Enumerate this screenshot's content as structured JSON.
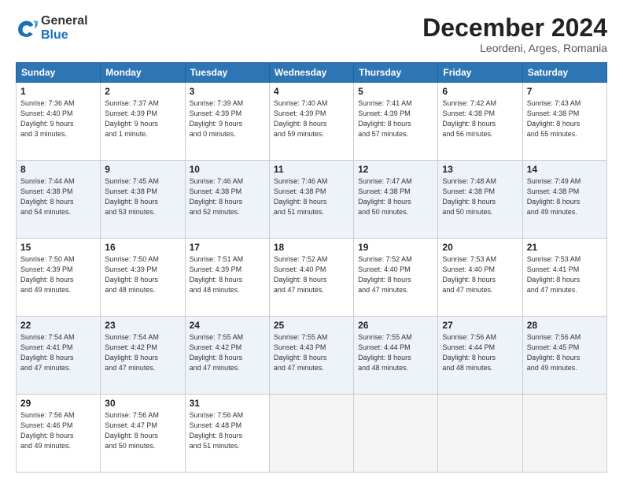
{
  "header": {
    "logo_general": "General",
    "logo_blue": "Blue",
    "month": "December 2024",
    "location": "Leordeni, Arges, Romania"
  },
  "weekdays": [
    "Sunday",
    "Monday",
    "Tuesday",
    "Wednesday",
    "Thursday",
    "Friday",
    "Saturday"
  ],
  "weeks": [
    [
      {
        "day": "1",
        "sunrise": "7:36 AM",
        "sunset": "4:40 PM",
        "daylight": "9 hours and 3 minutes."
      },
      {
        "day": "2",
        "sunrise": "7:37 AM",
        "sunset": "4:39 PM",
        "daylight": "9 hours and 1 minute."
      },
      {
        "day": "3",
        "sunrise": "7:39 AM",
        "sunset": "4:39 PM",
        "daylight": "9 hours and 0 minutes."
      },
      {
        "day": "4",
        "sunrise": "7:40 AM",
        "sunset": "4:39 PM",
        "daylight": "8 hours and 59 minutes."
      },
      {
        "day": "5",
        "sunrise": "7:41 AM",
        "sunset": "4:39 PM",
        "daylight": "8 hours and 57 minutes."
      },
      {
        "day": "6",
        "sunrise": "7:42 AM",
        "sunset": "4:38 PM",
        "daylight": "8 hours and 56 minutes."
      },
      {
        "day": "7",
        "sunrise": "7:43 AM",
        "sunset": "4:38 PM",
        "daylight": "8 hours and 55 minutes."
      }
    ],
    [
      {
        "day": "8",
        "sunrise": "7:44 AM",
        "sunset": "4:38 PM",
        "daylight": "8 hours and 54 minutes."
      },
      {
        "day": "9",
        "sunrise": "7:45 AM",
        "sunset": "4:38 PM",
        "daylight": "8 hours and 53 minutes."
      },
      {
        "day": "10",
        "sunrise": "7:46 AM",
        "sunset": "4:38 PM",
        "daylight": "8 hours and 52 minutes."
      },
      {
        "day": "11",
        "sunrise": "7:46 AM",
        "sunset": "4:38 PM",
        "daylight": "8 hours and 51 minutes."
      },
      {
        "day": "12",
        "sunrise": "7:47 AM",
        "sunset": "4:38 PM",
        "daylight": "8 hours and 50 minutes."
      },
      {
        "day": "13",
        "sunrise": "7:48 AM",
        "sunset": "4:38 PM",
        "daylight": "8 hours and 50 minutes."
      },
      {
        "day": "14",
        "sunrise": "7:49 AM",
        "sunset": "4:38 PM",
        "daylight": "8 hours and 49 minutes."
      }
    ],
    [
      {
        "day": "15",
        "sunrise": "7:50 AM",
        "sunset": "4:39 PM",
        "daylight": "8 hours and 49 minutes."
      },
      {
        "day": "16",
        "sunrise": "7:50 AM",
        "sunset": "4:39 PM",
        "daylight": "8 hours and 48 minutes."
      },
      {
        "day": "17",
        "sunrise": "7:51 AM",
        "sunset": "4:39 PM",
        "daylight": "8 hours and 48 minutes."
      },
      {
        "day": "18",
        "sunrise": "7:52 AM",
        "sunset": "4:40 PM",
        "daylight": "8 hours and 47 minutes."
      },
      {
        "day": "19",
        "sunrise": "7:52 AM",
        "sunset": "4:40 PM",
        "daylight": "8 hours and 47 minutes."
      },
      {
        "day": "20",
        "sunrise": "7:53 AM",
        "sunset": "4:40 PM",
        "daylight": "8 hours and 47 minutes."
      },
      {
        "day": "21",
        "sunrise": "7:53 AM",
        "sunset": "4:41 PM",
        "daylight": "8 hours and 47 minutes."
      }
    ],
    [
      {
        "day": "22",
        "sunrise": "7:54 AM",
        "sunset": "4:41 PM",
        "daylight": "8 hours and 47 minutes."
      },
      {
        "day": "23",
        "sunrise": "7:54 AM",
        "sunset": "4:42 PM",
        "daylight": "8 hours and 47 minutes."
      },
      {
        "day": "24",
        "sunrise": "7:55 AM",
        "sunset": "4:42 PM",
        "daylight": "8 hours and 47 minutes."
      },
      {
        "day": "25",
        "sunrise": "7:55 AM",
        "sunset": "4:43 PM",
        "daylight": "8 hours and 47 minutes."
      },
      {
        "day": "26",
        "sunrise": "7:55 AM",
        "sunset": "4:44 PM",
        "daylight": "8 hours and 48 minutes."
      },
      {
        "day": "27",
        "sunrise": "7:56 AM",
        "sunset": "4:44 PM",
        "daylight": "8 hours and 48 minutes."
      },
      {
        "day": "28",
        "sunrise": "7:56 AM",
        "sunset": "4:45 PM",
        "daylight": "8 hours and 49 minutes."
      }
    ],
    [
      {
        "day": "29",
        "sunrise": "7:56 AM",
        "sunset": "4:46 PM",
        "daylight": "8 hours and 49 minutes."
      },
      {
        "day": "30",
        "sunrise": "7:56 AM",
        "sunset": "4:47 PM",
        "daylight": "8 hours and 50 minutes."
      },
      {
        "day": "31",
        "sunrise": "7:56 AM",
        "sunset": "4:48 PM",
        "daylight": "8 hours and 51 minutes."
      },
      null,
      null,
      null,
      null
    ]
  ],
  "labels": {
    "sunrise": "Sunrise:",
    "sunset": "Sunset:",
    "daylight": "Daylight hours"
  }
}
